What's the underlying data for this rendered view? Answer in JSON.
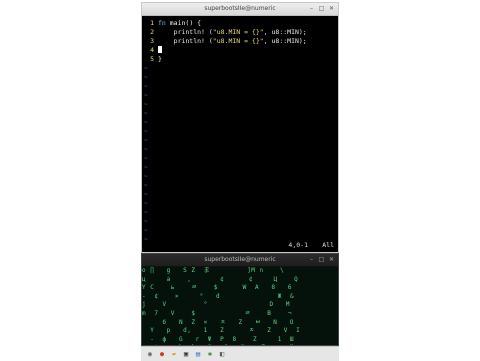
{
  "top_window": {
    "title": "superbootsIIe@numeric",
    "controls": {
      "minimize": "–",
      "maximize": "□",
      "close": "✕"
    },
    "lines": [
      {
        "num": "1",
        "parts": [
          {
            "t": "fn ",
            "c": "kw"
          },
          {
            "t": "main",
            "c": "mac"
          },
          {
            "t": "() {",
            "c": ""
          }
        ]
      },
      {
        "num": "2",
        "parts": [
          {
            "t": "    println! (",
            "c": ""
          },
          {
            "t": "\"u8.MIN = {}\"",
            "c": "str"
          },
          {
            "t": ", u8::MIN);",
            "c": ""
          }
        ]
      },
      {
        "num": "3",
        "parts": [
          {
            "t": "    println! (",
            "c": ""
          },
          {
            "t": "\"u8.MIN = {}\"",
            "c": "str"
          },
          {
            "t": ", u8::MIN);",
            "c": ""
          }
        ]
      },
      {
        "num": "4",
        "parts": []
      },
      {
        "num": "5",
        "parts": [
          {
            "t": "}",
            "c": ""
          }
        ]
      }
    ],
    "tilde": "~",
    "status_position": "4,0-1",
    "status_scroll": "All"
  },
  "bottom_window": {
    "title": "superbootsIIe@numeric",
    "controls": {
      "minimize": "–",
      "maximize": "□",
      "close": "✕"
    },
    "matrix_rows": [
      "o ∏   g   S Z  ま         ]M ∩    \\",
      "ц     a    ,       ¢      ¢     Ц    Q",
      "Y C    ь    ㄹ    $      W  A   8   6",
      "-  ¢    ×     °   d              Ж  &",
      "j    V         °               D   M",
      "m  7   V    $            ㄹ    B    ¬",
      "     б   N  Z  ×   ㅈ   Z   ㅂ   N   O",
      "  Y   р   d,   1   Z      ㅈ   Z   V  I",
      "  -  ф   G   r  Ψ  P  8    Z     1  Ш",
      "a  ф  a  h  k   ä   S   ö    Z  ∂   Ю"
    ]
  },
  "taskbar": {
    "items": [
      {
        "name": "start-menu-icon",
        "glyph": "◉",
        "color": "#666666"
      },
      {
        "name": "browser-icon",
        "glyph": "●",
        "color": "#d9381e"
      },
      {
        "name": "files-icon",
        "glyph": "▰",
        "color": "#d9a13b"
      },
      {
        "name": "terminal-icon",
        "glyph": "▣",
        "color": "#333333"
      },
      {
        "name": "editor-icon",
        "glyph": "▤",
        "color": "#3a76c8"
      },
      {
        "name": "settings-icon",
        "glyph": "✱",
        "color": "#4a8f3a"
      },
      {
        "name": "network-icon",
        "glyph": "◧",
        "color": "#5b5b5b"
      }
    ]
  }
}
